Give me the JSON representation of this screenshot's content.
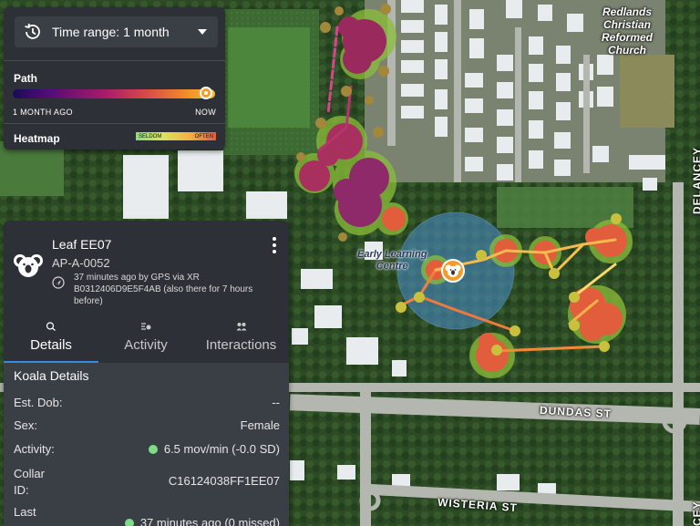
{
  "map": {
    "labels": {
      "church": [
        "Redlands",
        "Christian",
        "Reformed",
        "Church"
      ],
      "elc": [
        "Early Learning",
        "Centre"
      ],
      "delancey": "DELANCEY ST",
      "dundas": "DUNDAS ST",
      "wisteria": "WISTERIA ST",
      "delancey_bottom": "CEY ST"
    }
  },
  "controls": {
    "time_range_label": "Time range: 1 month",
    "path_title": "Path",
    "path_start": "1 MONTH AGO",
    "path_end": "NOW",
    "path_position": 1.0,
    "heatmap_title": "Heatmap",
    "heatmap_low": "SELDOM",
    "heatmap_high": "OFTEN"
  },
  "koala": {
    "name": "Leaf EE07",
    "tag": "AP-A-0052",
    "location_text": "37 minutes ago by GPS via XR B0312406D9E5F4AB (also there for 7 hours before)"
  },
  "tabs": [
    {
      "label": "Details",
      "icon": "details-icon",
      "active": true
    },
    {
      "label": "Activity",
      "icon": "activity-icon",
      "active": false
    },
    {
      "label": "Interactions",
      "icon": "interactions-icon",
      "active": false
    }
  ],
  "details": {
    "title": "Koala Details",
    "rows": [
      {
        "key": "Est. Dob:",
        "value": "--"
      },
      {
        "key": "Sex:",
        "value": "Female"
      },
      {
        "key": "Activity:",
        "value": "6.5 mov/min (-0.0 SD)"
      },
      {
        "key": "Collar ID:",
        "key_line1": "Collar",
        "key_line2": "ID:",
        "value": "C16124038FF1EE07"
      },
      {
        "key": "Last",
        "value": "37 minutes ago (0 missed)"
      }
    ]
  },
  "colors": {
    "panel_bg": "#2d3036",
    "section_bg": "#3a3e45",
    "active_tab": "#2f8de4",
    "activity_dot": "#7ddc85",
    "koala_marker": "#f39c2d"
  }
}
